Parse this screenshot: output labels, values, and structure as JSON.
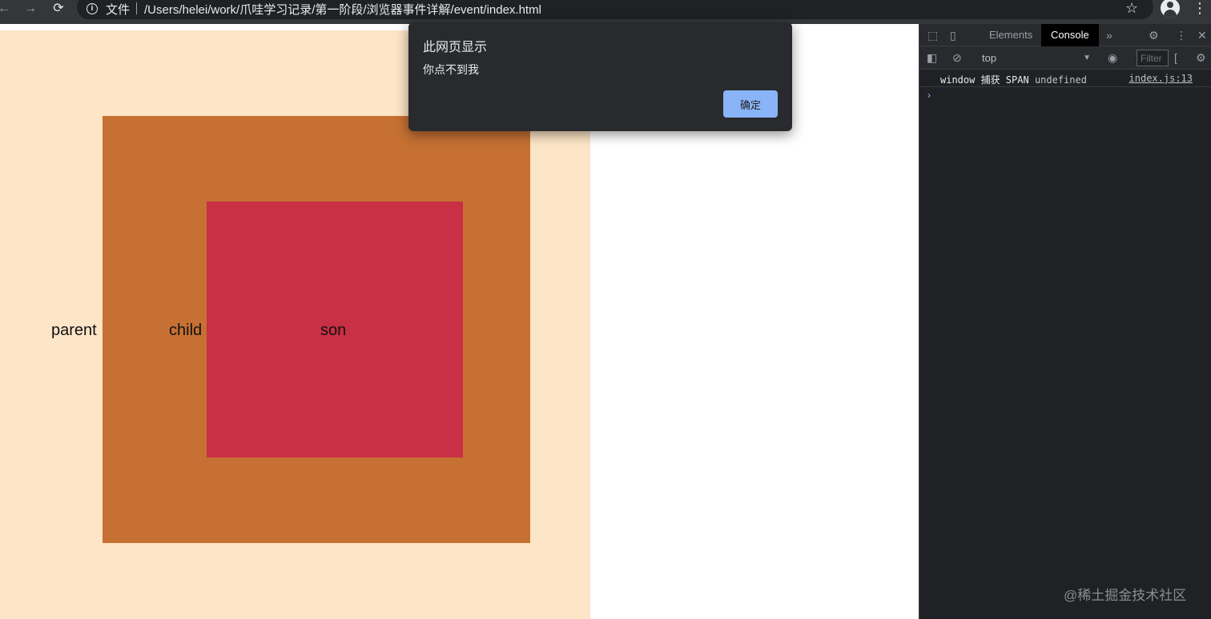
{
  "browser": {
    "scheme_label": "文件",
    "url": "/Users/helei/work/爪哇学习记录/第一阶段/浏览器事件详解/event/index.html"
  },
  "page": {
    "labels": {
      "parent": "parent",
      "child": "child",
      "son": "son"
    },
    "colors": {
      "parent": "#fde5c7",
      "child": "#c67033",
      "son": "#c92f45"
    }
  },
  "dialog": {
    "title": "此网页显示",
    "message": "你点不到我",
    "ok_label": "确定"
  },
  "devtools": {
    "tabs": [
      {
        "label": "Elements",
        "active": false
      },
      {
        "label": "Console",
        "active": true
      }
    ],
    "context": "top",
    "filter_placeholder": "Filter",
    "console_lines": [
      {
        "message": "window 捕获 SPAN",
        "value": "undefined",
        "source": "index.js:13"
      }
    ]
  },
  "watermark": "@稀土掘金技术社区"
}
